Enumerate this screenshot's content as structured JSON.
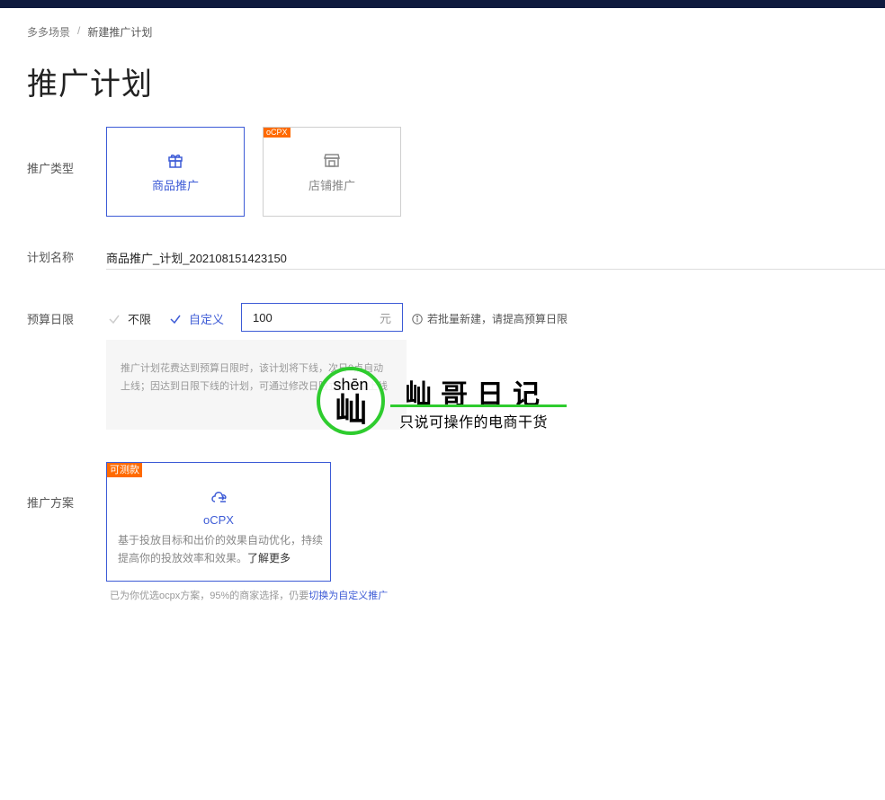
{
  "breadcrumb": {
    "parent": "多多场景",
    "separator": "/",
    "current": "新建推广计划"
  },
  "page_title": "推广计划",
  "promotion_type": {
    "label": "推广类型",
    "options": [
      {
        "label": "商品推广",
        "icon": "gift-icon",
        "selected": true
      },
      {
        "label": "店铺推广",
        "icon": "store-icon",
        "selected": false,
        "tag": "oCPX"
      }
    ]
  },
  "plan_name": {
    "label": "计划名称",
    "value": "商品推广_计划_202108151423150"
  },
  "daily_budget": {
    "label": "预算日限",
    "option_unlimited": "不限",
    "option_custom": "自定义",
    "selected": "custom",
    "value": "100",
    "unit": "元",
    "hint": "若批量新建，请提高预算日限",
    "note": "推广计划花费达到预算日限时，该计划将下线，次日0点自动上线；因达到日限下线的计划，可通过修改日限立刻恢复上线"
  },
  "watermark": {
    "pinyin": "shēn",
    "char": "屾",
    "title": "屾哥日记",
    "subtitle": "只说可操作的电商干货"
  },
  "scheme": {
    "label": "推广方案",
    "tag": "可测款",
    "name": "oCPX",
    "icon": "cloud-link-icon",
    "desc": "基于投放目标和出价的效果自动优化，持续提高你的投放效率和效果。",
    "more": "了解更多",
    "footnote": "已为你优选ocpx方案，95%的商家选择，仍要",
    "footnote_link": "切换为自定义推广"
  },
  "colors": {
    "primary": "#3d5bd6",
    "tag": "#ff6a00",
    "topbar": "#0e1a3e",
    "watermark_green": "#2ecc2e"
  }
}
